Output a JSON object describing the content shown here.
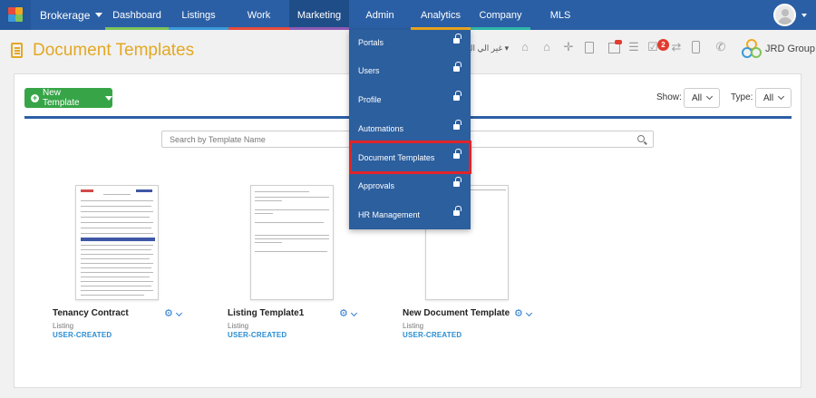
{
  "topbar": {
    "brand": "Brokerage",
    "tabs": [
      {
        "label": "Dashboard",
        "bar": "#7ec35a"
      },
      {
        "label": "Listings",
        "bar": "#3a9ad9"
      },
      {
        "label": "Work",
        "bar": "#e84b3c"
      },
      {
        "label": "Marketing",
        "bar": "#8e5bb5"
      },
      {
        "label": "Admin",
        "bar": "#2b5fa5"
      },
      {
        "label": "Analytics",
        "bar": "#f0a91f"
      },
      {
        "label": "Company",
        "bar": "#2fb5a8"
      },
      {
        "label": "MLS",
        "bar": "#2b5fa5"
      }
    ],
    "active_tab": "Marketing",
    "colors": {
      "bar_bg": "#2b5fa5",
      "active_bg": "#1f4d87"
    }
  },
  "header": {
    "title": "Document Templates",
    "language": "غير الي الع",
    "notifications_count": "2",
    "company": "JRD Group",
    "icons": [
      "home-icon",
      "house-icon",
      "crosshair-icon",
      "document-icon",
      "calendar-icon",
      "list-icon",
      "checkbox-icon",
      "transfer-icon",
      "mobile-icon",
      "phone-icon"
    ]
  },
  "toolbar": {
    "new_template_label": "New Template",
    "show_label": "Show:",
    "show_value": "All",
    "type_label": "Type:",
    "type_value": "All"
  },
  "search": {
    "placeholder": "Search by Template Name"
  },
  "templates": [
    {
      "name": "Tenancy Contract",
      "category": "Listing",
      "tag": "USER-CREATED"
    },
    {
      "name": "Listing Template1",
      "category": "Listing",
      "tag": "USER-CREATED"
    },
    {
      "name": "New Document Template",
      "category": "Listing",
      "tag": "USER-CREATED"
    }
  ],
  "admin_menu": {
    "items": [
      "Portals",
      "Users",
      "Profile",
      "Automations",
      "Document Templates",
      "Approvals",
      "HR Management"
    ],
    "highlighted": "Document Templates"
  }
}
